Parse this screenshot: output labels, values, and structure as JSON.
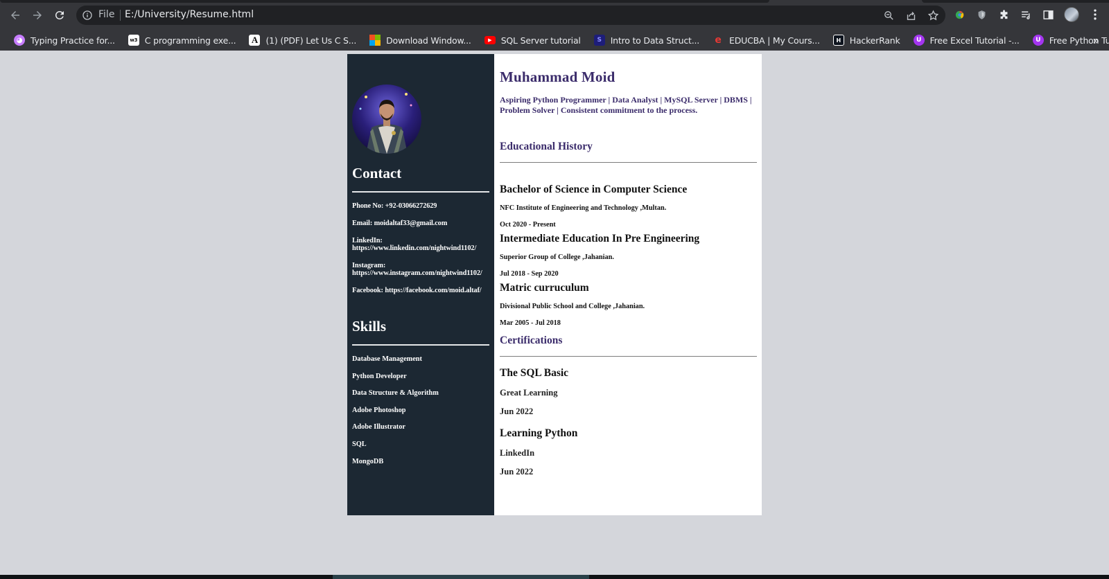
{
  "browser": {
    "scheme_label": "File",
    "url": "E:/University/Resume.html",
    "bookmarks": [
      {
        "label": "Typing Practice for...",
        "icon": "ghost-icon",
        "color": "#c77dff"
      },
      {
        "label": "C programming exe...",
        "icon": "w3schools-icon",
        "color": "#ffffff"
      },
      {
        "label": "(1) (PDF) Let Us C S...",
        "icon": "academia-icon",
        "color": "#ffffff"
      },
      {
        "label": "Download Window...",
        "icon": "microsoft-icon",
        "color": "#f25022"
      },
      {
        "label": "SQL Server tutorial",
        "icon": "youtube-icon",
        "color": "#ff0000"
      },
      {
        "label": "Intro to Data Struct...",
        "icon": "scrimba-icon",
        "color": "#3a3ad6"
      },
      {
        "label": "EDUCBA | My Cours...",
        "icon": "educba-icon",
        "color": "#e53935"
      },
      {
        "label": "HackerRank",
        "icon": "hackerrank-icon",
        "color": "#1ba94c"
      },
      {
        "label": "Free Excel Tutorial -...",
        "icon": "udemy-icon",
        "color": "#a435f0"
      },
      {
        "label": "Free Python Tutoria...",
        "icon": "udemy-icon",
        "color": "#a435f0"
      }
    ],
    "more_label": "»"
  },
  "resume": {
    "name": "Muhammad Moid",
    "tagline": "Aspiring Python Programmer | Data Analyst | MySQL Server | DBMS | Problem Solver | Consistent commitment to the process.",
    "contact": {
      "heading": "Contact",
      "phone": "Phone No: +92-03066272629",
      "email": "Email: moidaltaf33@gmail.com",
      "linkedin_label": "LinkedIn:",
      "linkedin_url": "https://www.linkedin.com/nightwind1102/",
      "instagram_label": "Instagram:",
      "instagram_url": "https://www.instagram.com/nightwind1102/",
      "facebook": "Facebook: https://facebook.com/moid.altaf/"
    },
    "skills": {
      "heading": "Skills",
      "items": [
        "Database Management",
        "Python Developer",
        "Data Structure & Algorithm",
        "Adobe Photoshop",
        "Adobe Illustrator",
        "SQL",
        "MongoDB"
      ]
    },
    "education": {
      "heading": "Educational History",
      "items": [
        {
          "degree": "Bachelor of Science in Computer Science",
          "institute": "NFC Institute of Engineering and Technology ,Multan.",
          "dates": "Oct 2020 - Present"
        },
        {
          "degree": "Intermediate Education In Pre Engineering",
          "institute": "Superior Group of College ,Jahanian.",
          "dates": "Jul 2018 - Sep 2020"
        },
        {
          "degree": "Matric curruculum",
          "institute": "Divisional Public School and College ,Jahanian.",
          "dates": "Mar 2005 - Jul 2018"
        }
      ]
    },
    "certifications": {
      "heading": "Certifications",
      "items": [
        {
          "title": "The SQL Basic",
          "issuer": "Great Learning",
          "date": "Jun 2022"
        },
        {
          "title": "Learning Python",
          "issuer": "LinkedIn",
          "date": "Jun 2022"
        }
      ]
    }
  }
}
